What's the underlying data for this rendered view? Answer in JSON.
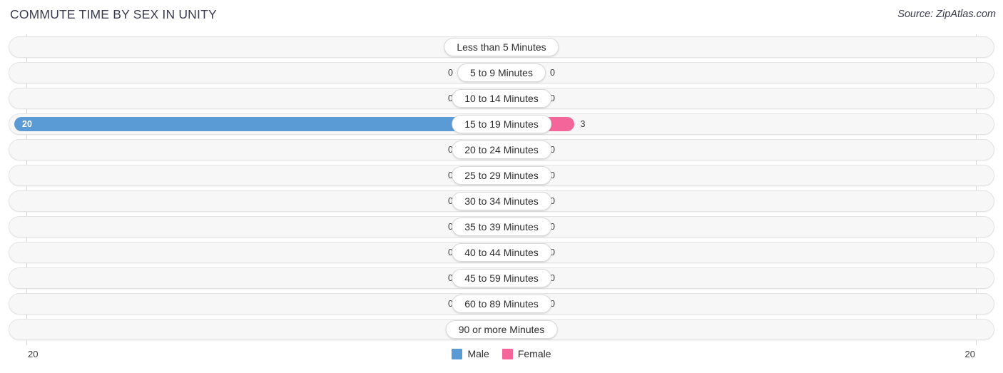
{
  "header": {
    "title": "COMMUTE TIME BY SEX IN UNITY",
    "source": "Source: ZipAtlas.com"
  },
  "axis": {
    "left_label": "20",
    "right_label": "20"
  },
  "legend": {
    "male_label": "Male",
    "female_label": "Female"
  },
  "colors": {
    "male_active": "#5b9bd5",
    "female_active": "#f4659a",
    "male_muted": "#aec9ec",
    "female_muted": "#f9a8c2",
    "track": "#f7f7f7",
    "title": "#3b3b4f"
  },
  "chart_data": {
    "type": "bar",
    "title": "COMMUTE TIME BY SEX IN UNITY",
    "subtitle": "Source: ZipAtlas.com",
    "orientation": "horizontal",
    "style": "diverging-bidirectional",
    "xlabel": "",
    "ylabel": "",
    "xlim": [
      20,
      20
    ],
    "axis_max": 20,
    "grid": true,
    "legend_position": "bottom-center",
    "categories": [
      "Less than 5 Minutes",
      "5 to 9 Minutes",
      "10 to 14 Minutes",
      "15 to 19 Minutes",
      "20 to 24 Minutes",
      "25 to 29 Minutes",
      "30 to 34 Minutes",
      "35 to 39 Minutes",
      "40 to 44 Minutes",
      "45 to 59 Minutes",
      "60 to 89 Minutes",
      "90 or more Minutes"
    ],
    "series": [
      {
        "name": "Male",
        "color": "#5b9bd5",
        "values": [
          0,
          0,
          0,
          20,
          0,
          0,
          0,
          0,
          0,
          0,
          0,
          0
        ]
      },
      {
        "name": "Female",
        "color": "#f4659a",
        "values": [
          0,
          0,
          0,
          3,
          0,
          0,
          0,
          0,
          0,
          0,
          0,
          0
        ]
      }
    ]
  },
  "rows": [
    {
      "label": "Less than 5 Minutes",
      "male": "0",
      "female": "0"
    },
    {
      "label": "5 to 9 Minutes",
      "male": "0",
      "female": "0"
    },
    {
      "label": "10 to 14 Minutes",
      "male": "0",
      "female": "0"
    },
    {
      "label": "15 to 19 Minutes",
      "male": "20",
      "female": "3"
    },
    {
      "label": "20 to 24 Minutes",
      "male": "0",
      "female": "0"
    },
    {
      "label": "25 to 29 Minutes",
      "male": "0",
      "female": "0"
    },
    {
      "label": "30 to 34 Minutes",
      "male": "0",
      "female": "0"
    },
    {
      "label": "35 to 39 Minutes",
      "male": "0",
      "female": "0"
    },
    {
      "label": "40 to 44 Minutes",
      "male": "0",
      "female": "0"
    },
    {
      "label": "45 to 59 Minutes",
      "male": "0",
      "female": "0"
    },
    {
      "label": "60 to 89 Minutes",
      "male": "0",
      "female": "0"
    },
    {
      "label": "90 or more Minutes",
      "male": "0",
      "female": "0"
    }
  ]
}
